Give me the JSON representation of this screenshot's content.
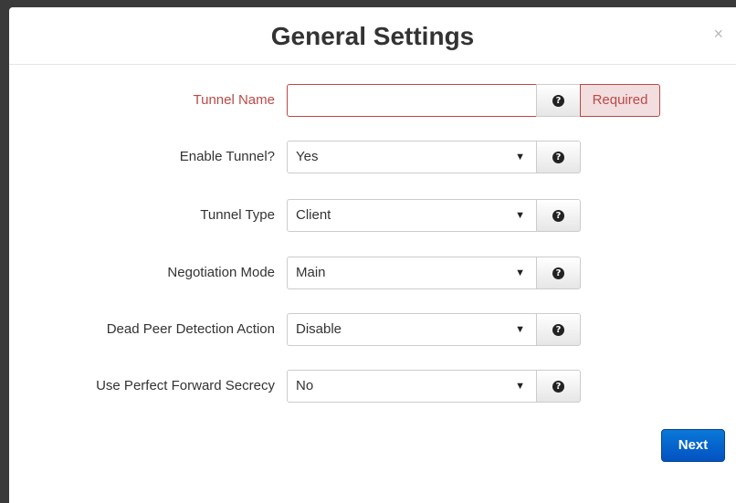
{
  "modal": {
    "title": "General Settings",
    "close_glyph": "×"
  },
  "form": {
    "tunnel_name": {
      "label": "Tunnel Name",
      "value": "",
      "addon": "Required",
      "help_icon": "question-circle-icon"
    },
    "fields": [
      {
        "label": "Enable Tunnel?",
        "value": "Yes"
      },
      {
        "label": "Tunnel Type",
        "value": "Client"
      },
      {
        "label": "Negotiation Mode",
        "value": "Main"
      },
      {
        "label": "Dead Peer Detection Action",
        "value": "Disable"
      },
      {
        "label": "Use Perfect Forward Secrecy",
        "value": "No"
      }
    ],
    "caret_glyph": "▼",
    "help_glyph": "?"
  },
  "footer": {
    "next_label": "Next"
  },
  "colors": {
    "error": "#b94a48",
    "error_bg": "#f2dede",
    "primary": "#0a6fd6"
  }
}
